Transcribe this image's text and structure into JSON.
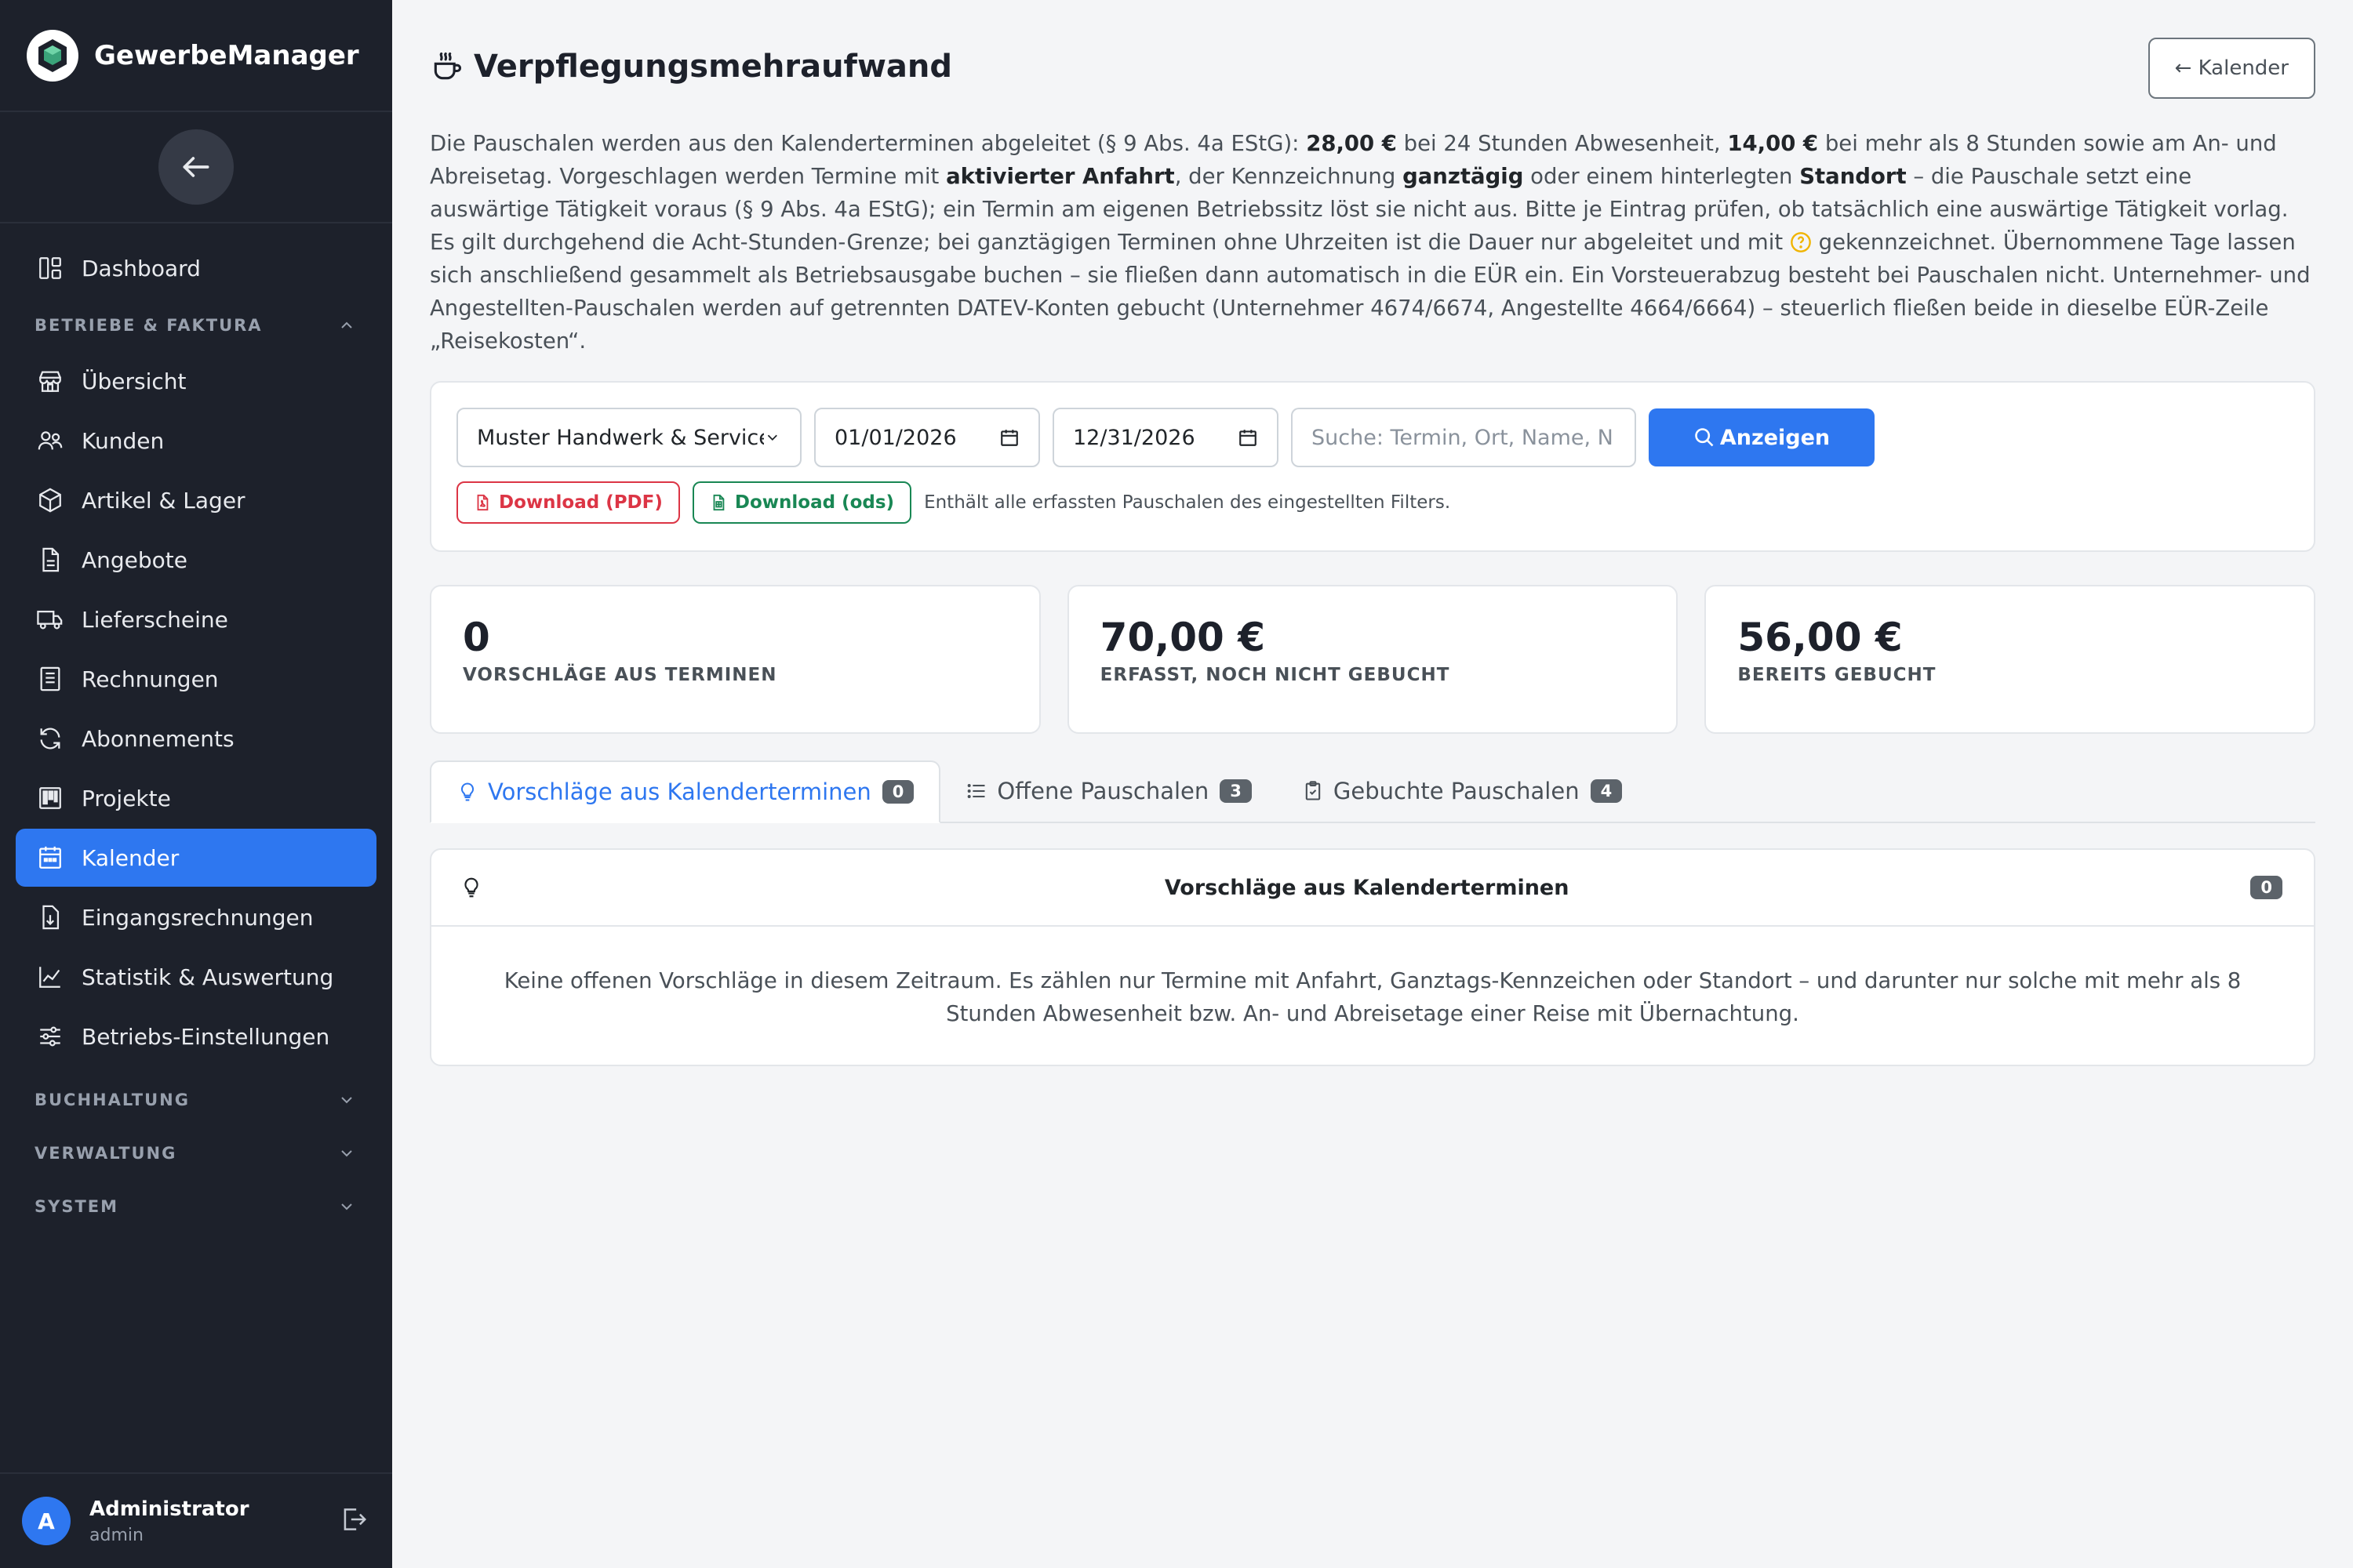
{
  "app": {
    "name": "GewerbeManager"
  },
  "sidebar": {
    "items_top": [
      {
        "label": "Dashboard",
        "icon": "dashboard-icon"
      }
    ],
    "section_betriebe": "BETRIEBE & FAKTURA",
    "items": [
      {
        "label": "Übersicht",
        "icon": "shop-icon"
      },
      {
        "label": "Kunden",
        "icon": "people-icon"
      },
      {
        "label": "Artikel & Lager",
        "icon": "box-icon"
      },
      {
        "label": "Angebote",
        "icon": "document-icon"
      },
      {
        "label": "Lieferscheine",
        "icon": "truck-icon"
      },
      {
        "label": "Rechnungen",
        "icon": "receipt-icon"
      },
      {
        "label": "Abonnements",
        "icon": "refresh-icon"
      },
      {
        "label": "Projekte",
        "icon": "kanban-icon"
      },
      {
        "label": "Kalender",
        "icon": "calendar-icon",
        "active": true
      },
      {
        "label": "Eingangsrechnungen",
        "icon": "file-download-icon"
      },
      {
        "label": "Statistik & Auswertung",
        "icon": "chart-line-icon"
      },
      {
        "label": "Betriebs-Einstellungen",
        "icon": "sliders-icon"
      }
    ],
    "section_buchhaltung": "BUCHHALTUNG",
    "section_verwaltung": "VERWALTUNG",
    "section_system": "SYSTEM",
    "user": {
      "initial": "A",
      "name": "Administrator",
      "role": "admin"
    }
  },
  "header": {
    "title": "Verpflegungsmehraufwand",
    "back_label": "← Kalender"
  },
  "intro": {
    "p1": "Die Pauschalen werden aus den Kalenderterminen abgeleitet (§ 9 Abs. 4a EStG): ",
    "b1": "28,00 €",
    "p2": " bei 24 Stunden Abwesenheit, ",
    "b2": "14,00 €",
    "p3": " bei mehr als 8 Stunden sowie am An- und Abreisetag. Vorgeschlagen werden Termine mit ",
    "b3": "aktivierter Anfahrt",
    "p4": ", der Kennzeichnung ",
    "b4": "ganztägig",
    "p5": " oder einem hinterlegten ",
    "b5": "Standort",
    "p6": " – die Pauschale setzt eine auswärtige Tätigkeit voraus (§ 9 Abs. 4a EStG); ein Termin am eigenen Betriebssitz löst sie nicht aus. Bitte je Eintrag prüfen, ob tatsächlich eine auswärtige Tätigkeit vorlag. Es gilt durchgehend die Acht-Stunden-Grenze; bei ganztägigen Terminen ohne Uhrzeiten ist die Dauer nur abgeleitet und mit ",
    "p7": " gekennzeichnet. Übernommene Tage lassen sich anschließend gesammelt als Betriebsausgabe buchen – sie fließen dann automatisch in die EÜR ein. Ein Vorsteuerabzug besteht bei Pauschalen nicht. Unternehmer- und Angestellten-Pauschalen werden auf getrennten DATEV-Konten gebucht (Unternehmer 4674/6674, Angestellte 4664/6664) – steuerlich fließen beide in dieselbe EÜR-Zeile „Reisekosten“."
  },
  "filter": {
    "company": "Muster Handwerk & Service G",
    "date_from": "01/01/2026",
    "date_to": "12/31/2026",
    "search_placeholder": "Suche: Termin, Ort, Name, N",
    "submit_label": "Anzeigen",
    "download_pdf": "Download (PDF)",
    "download_ods": "Download (ods)",
    "note": "Enthält alle erfassten Pauschalen des eingestellten Filters."
  },
  "stats": [
    {
      "value": "0",
      "label": "VORSCHLÄGE AUS TERMINEN"
    },
    {
      "value": "70,00 €",
      "label": "ERFASST, NOCH NICHT GEBUCHT"
    },
    {
      "value": "56,00 €",
      "label": "BEREITS GEBUCHT"
    }
  ],
  "tabs": [
    {
      "label": "Vorschläge aus Kalenderterminen",
      "count": "0",
      "active": true
    },
    {
      "label": "Offene Pauschalen",
      "count": "3"
    },
    {
      "label": "Gebuchte Pauschalen",
      "count": "4"
    }
  ],
  "panel": {
    "title": "Vorschläge aus Kalenderterminen",
    "count": "0",
    "empty_text": "Keine offenen Vorschläge in diesem Zeitraum. Es zählen nur Termine mit Anfahrt, Ganztags-Kennzeichen oder Standort – und darunter nur solche mit mehr als 8 Stunden Abwesenheit bzw. An- und Abreisetage einer Reise mit Übernachtung."
  },
  "colors": {
    "accent": "#2e77f0",
    "sidebar": "#1d212b",
    "danger": "#dc3545",
    "success": "#198754",
    "warning": "#f0b400"
  }
}
